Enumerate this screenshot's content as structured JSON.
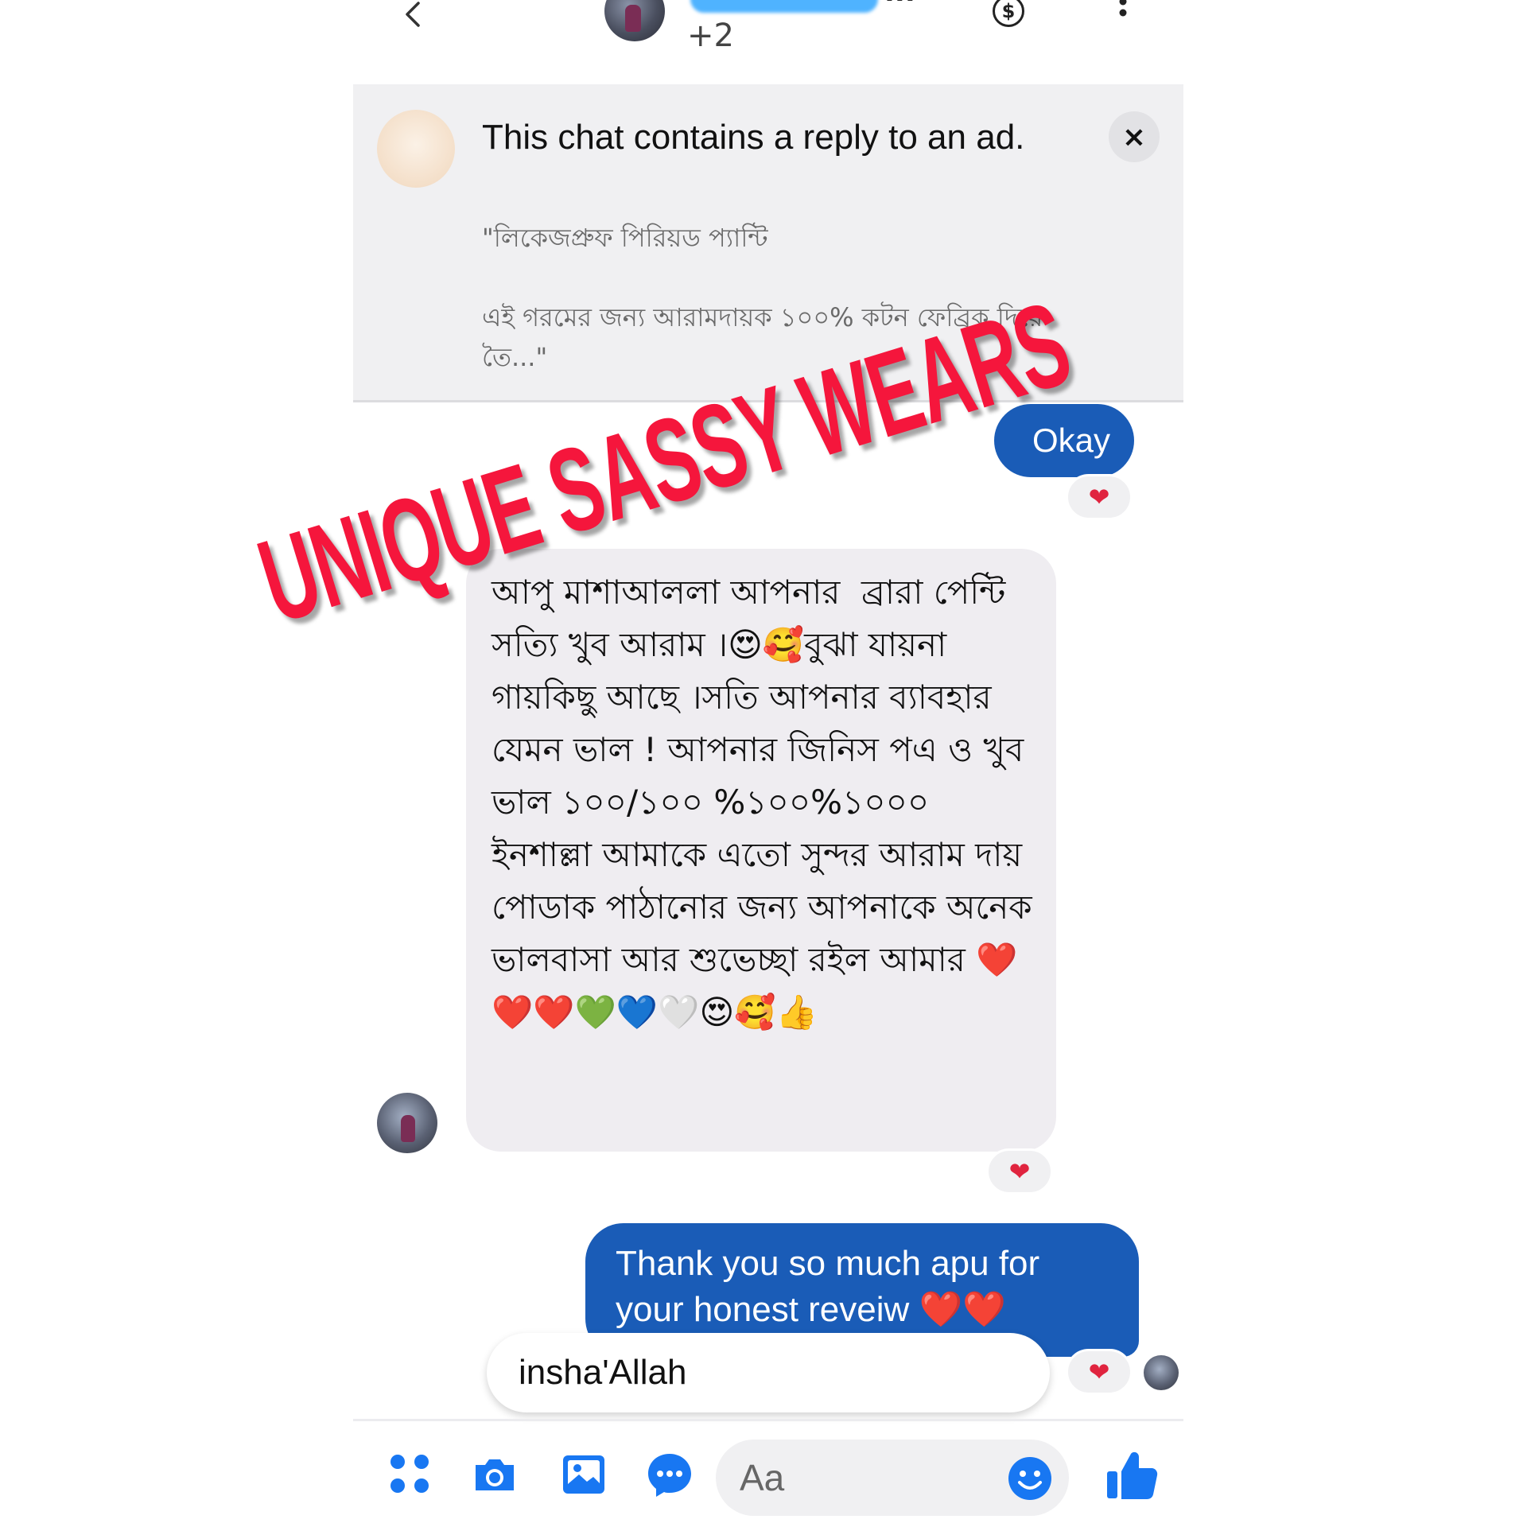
{
  "header": {
    "participants_extra": "+2",
    "name_dots": "..."
  },
  "ad_banner": {
    "title": "This chat contains a reply to an ad.",
    "quote": "\"লিকেজপ্রুফ পিরিয়ড প্যান্টি\n\nএই গরমের জন্য আরামদায়ক ১০০% কটন ফেব্রিক দিয়ে তৈ...\"",
    "close_label": "×"
  },
  "messages": {
    "okay": {
      "text": "Okay",
      "reaction": "❤"
    },
    "incoming": {
      "text": "আপু মাশাআললা আপনার  ব্রারা পেন্টি সত্যি খুব আরাম ।😍🥰বুঝা যায়না গায়কিছু আছে ।সতি আপনার ব্যাবহার যেমন ভাল ! আপনার জিনিস পএ ও খুব ভাল ১০০/১০০ %১০০%১০০০ ইনশাল্লা আমাকে এতো সুন্দর আরাম দায় পোডাক পাঠানোর জন্য আপনাকে অনেক ভালবাসা আর শুভেচ্ছা রইল আমার ❤️❤️❤️💚💙🤍😍🥰👍",
      "reaction": "❤"
    },
    "thanks": {
      "text": "Thank you so much apu for your honest reveiw ❤️❤️",
      "reaction": "❤"
    },
    "reply": {
      "text": "insha'Allah"
    }
  },
  "composer": {
    "placeholder": "Aa"
  },
  "watermark": {
    "text": "UNIQUE SASSY WEARS"
  },
  "colors": {
    "outgoing_bubble": "#1a5cb7",
    "incoming_bubble": "#efedf1",
    "messenger_blue": "#0a7cff",
    "watermark": "#f5163c",
    "reaction_heart": "#e0243f"
  },
  "icons": [
    "back-icon",
    "dollar-icon",
    "more-icon",
    "close-icon",
    "apps-icon",
    "camera-icon",
    "gallery-icon",
    "chat-icon",
    "smiley-icon",
    "like-icon",
    "heart-icon"
  ]
}
